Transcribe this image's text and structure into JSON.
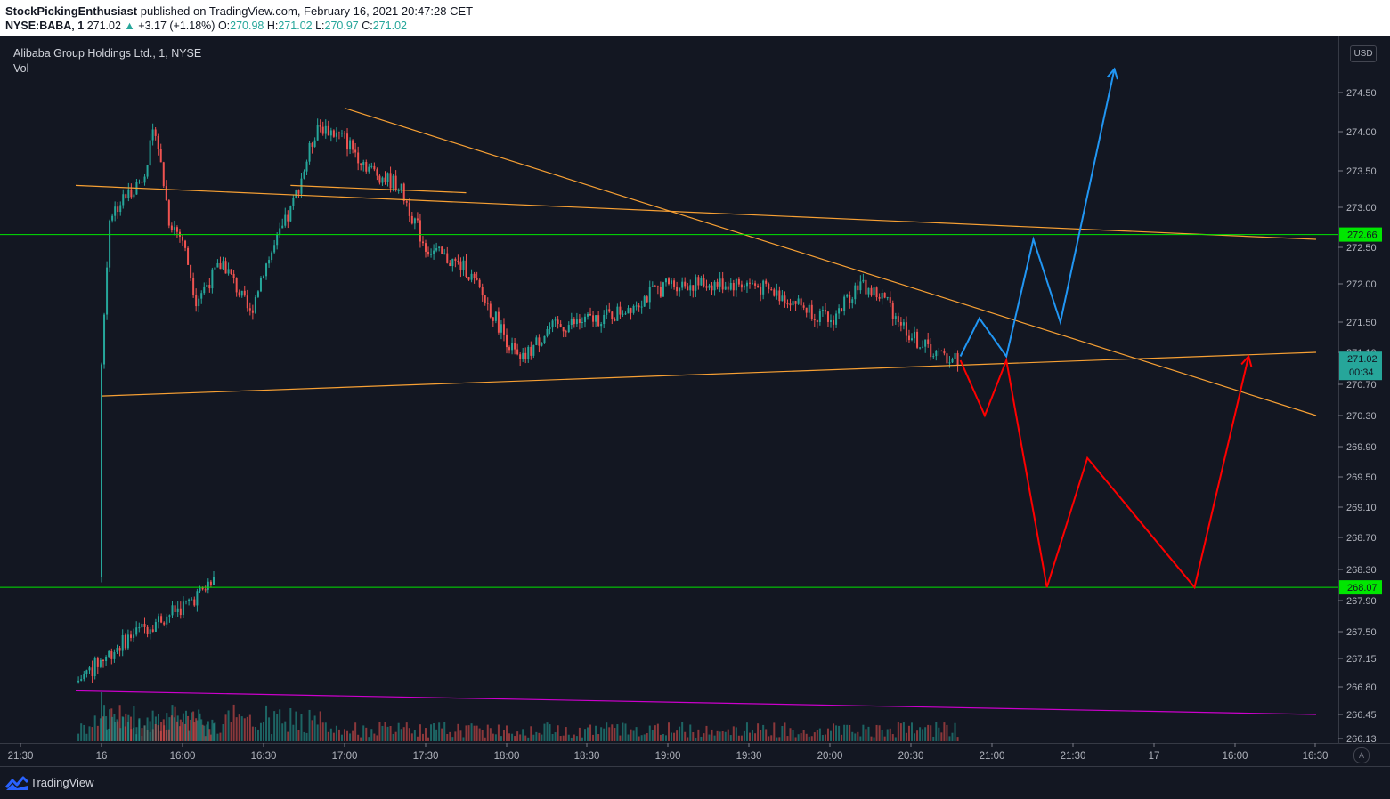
{
  "header": {
    "author": "StockPickingEnthusiast",
    "published": "published on TradingView.com, February 16, 2021 20:47:28 CET",
    "ticker": "NYSE:BABA, 1",
    "last": "271.02",
    "change": "+3.17 (+1.18%)",
    "o_label": "O:",
    "o_value": "270.98",
    "h_label": "H:",
    "h_value": "271.02",
    "l_label": "L:",
    "l_value": "270.97",
    "c_label": "C:",
    "c_value": "271.02"
  },
  "legend": {
    "title": "Alibaba Group Holdings Ltd., 1, NYSE",
    "vol": "Vol"
  },
  "currency": "USD",
  "footer": {
    "brand": "TradingView",
    "auto_label": "A"
  },
  "colors": {
    "background": "#131722",
    "up": "#26a69a",
    "down": "#ef5350",
    "trendline": "#f7a034",
    "level": "#00e600",
    "bull_path": "#2196f3",
    "bear_path": "#ff0000",
    "vol_trend": "#cc00cc",
    "last_price_badge": "#26a69a"
  },
  "chart_data": {
    "type": "candlestick",
    "symbol": "NYSE:BABA",
    "interval": "1",
    "y_ticks": [
      274.5,
      274.0,
      273.5,
      273.0,
      272.5,
      272.0,
      271.5,
      271.1,
      270.7,
      270.3,
      269.9,
      269.5,
      269.1,
      268.7,
      268.3,
      267.9,
      267.5,
      267.15,
      266.8,
      266.45,
      266.13
    ],
    "y_tick_labels": [
      "274.50",
      "274.00",
      "273.50",
      "273.00",
      "272.50",
      "272.00",
      "271.50",
      "271.10",
      "270.70",
      "270.30",
      "269.90",
      "269.50",
      "269.10",
      "268.70",
      "268.30",
      "267.90",
      "267.50",
      "267.15",
      "266.80",
      "266.45",
      "266.13"
    ],
    "x_ticks": [
      "21:30",
      "16",
      "16:00",
      "16:30",
      "17:00",
      "17:30",
      "18:00",
      "18:30",
      "19:00",
      "19:30",
      "20:00",
      "20:30",
      "21:00",
      "21:30",
      "17",
      "16:00",
      "16:30"
    ],
    "levels": [
      {
        "label": "272.66",
        "value": 272.66
      },
      {
        "label": "268.07",
        "value": 268.07
      }
    ],
    "last_price": {
      "label": "271.02",
      "value": 271.02,
      "countdown": "00:34"
    },
    "price_path": [
      {
        "t": "prev 15:20",
        "p": 266.85
      },
      {
        "t": "prev 15:40",
        "p": 267.45
      },
      {
        "t": "prev 16:00",
        "p": 267.85
      },
      {
        "t": "prev 16:10",
        "p": 268.15
      },
      {
        "t": "16 15:30",
        "p": 270.95
      },
      {
        "t": "16 15:33",
        "p": 272.9
      },
      {
        "t": "16 15:45",
        "p": 273.4
      },
      {
        "t": "16 15:50",
        "p": 274.05
      },
      {
        "t": "16 15:55",
        "p": 272.85
      },
      {
        "t": "16 16:00",
        "p": 272.6
      },
      {
        "t": "16 16:05",
        "p": 271.8
      },
      {
        "t": "16 16:15",
        "p": 272.3
      },
      {
        "t": "16 16:25",
        "p": 271.6
      },
      {
        "t": "16 16:30",
        "p": 272.2
      },
      {
        "t": "16 16:40",
        "p": 272.95
      },
      {
        "t": "16 16:50",
        "p": 274.1
      },
      {
        "t": "16 17:00",
        "p": 273.9
      },
      {
        "t": "16 17:10",
        "p": 273.5
      },
      {
        "t": "16 17:20",
        "p": 273.3
      },
      {
        "t": "16 17:30",
        "p": 272.5
      },
      {
        "t": "16 17:45",
        "p": 272.2
      },
      {
        "t": "16 17:55",
        "p": 271.6
      },
      {
        "t": "16 18:05",
        "p": 270.95
      },
      {
        "t": "16 18:15",
        "p": 271.4
      },
      {
        "t": "16 18:40",
        "p": 271.6
      },
      {
        "t": "16 19:00",
        "p": 272.0
      },
      {
        "t": "16 19:30",
        "p": 272.0
      },
      {
        "t": "16 19:45",
        "p": 271.8
      },
      {
        "t": "16 20:00",
        "p": 271.5
      },
      {
        "t": "16 20:10",
        "p": 272.0
      },
      {
        "t": "16 20:20",
        "p": 271.8
      },
      {
        "t": "16 20:30",
        "p": 271.3
      },
      {
        "t": "16 20:40",
        "p": 271.05
      },
      {
        "t": "16 20:47",
        "p": 271.02
      }
    ],
    "drawings": [
      {
        "kind": "trendline",
        "name": "upper-resistance",
        "from": {
          "t": "16 17:00",
          "p": 274.3
        },
        "to": {
          "t": "17 16:30",
          "p": 270.3
        }
      },
      {
        "kind": "trendline",
        "name": "long-resistance",
        "from": {
          "t": "prev 15:20",
          "p": 273.3
        },
        "to": {
          "t": "17 16:30",
          "p": 272.6
        }
      },
      {
        "kind": "trendline",
        "name": "short-resistance",
        "from": {
          "t": "16 16:40",
          "p": 273.3
        },
        "to": {
          "t": "16 17:45",
          "p": 273.2
        }
      },
      {
        "kind": "trendline",
        "name": "support",
        "from": {
          "t": "16 15:30",
          "p": 270.55
        },
        "to": {
          "t": "17 16:30",
          "p": 271.1
        }
      },
      {
        "kind": "trendline",
        "name": "volume-trend",
        "from": {
          "t": "prev 15:20",
          "p": 266.75
        },
        "to": {
          "t": "17 16:30",
          "p": 266.45
        }
      }
    ],
    "scenarios": [
      {
        "name": "bullish",
        "points": [
          {
            "t": "16 20:48",
            "p": 271.05
          },
          {
            "t": "16 20:55",
            "p": 271.55
          },
          {
            "t": "16 21:05",
            "p": 271.05
          },
          {
            "t": "16 21:15",
            "p": 272.6
          },
          {
            "t": "16 21:25",
            "p": 271.5
          },
          {
            "t": "16 21:45",
            "p": 274.8
          }
        ]
      },
      {
        "name": "bearish",
        "points": [
          {
            "t": "16 20:48",
            "p": 271.0
          },
          {
            "t": "16 20:57",
            "p": 270.3
          },
          {
            "t": "16 21:05",
            "p": 271.0
          },
          {
            "t": "16 21:20",
            "p": 268.07
          },
          {
            "t": "16 21:35",
            "p": 269.75
          },
          {
            "t": "17 15:45",
            "p": 268.07
          },
          {
            "t": "17 16:05",
            "p": 271.05
          }
        ]
      }
    ]
  }
}
